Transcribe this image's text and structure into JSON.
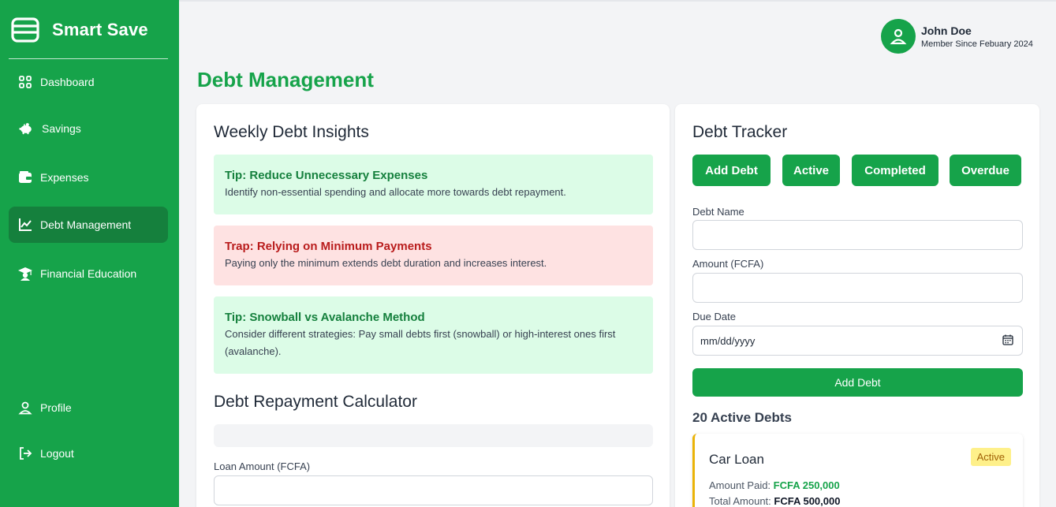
{
  "sidebar": {
    "brand": "Smart Save",
    "items": [
      {
        "label": "Dashboard",
        "icon": "grid-icon"
      },
      {
        "label": "Savings",
        "icon": "piggy-bank-icon"
      },
      {
        "label": "Expenses",
        "icon": "wallet-icon"
      },
      {
        "label": "Debt Management",
        "icon": "chart-line-icon",
        "active": true
      },
      {
        "label": "Financial Education",
        "icon": "graduation-cap-icon"
      },
      {
        "label": "Profile",
        "icon": "user-icon"
      },
      {
        "label": "Logout",
        "icon": "logout-icon"
      }
    ]
  },
  "header": {
    "user_name": "John Doe",
    "member_since": "Member Since Febuary 2024"
  },
  "page_title": "Debt Management",
  "insights": {
    "heading": "Weekly Debt Insights",
    "notes": [
      {
        "kind": "tip",
        "title": "Tip: Reduce Unnecessary Expenses",
        "body": "Identify non-essential spending and allocate more towards debt repayment."
      },
      {
        "kind": "trap",
        "title": "Trap: Relying on Minimum Payments",
        "body": "Paying only the minimum extends debt duration and increases interest."
      },
      {
        "kind": "tip",
        "title": "Tip: Snowball vs Avalanche Method",
        "body": "Consider different strategies: Pay small debts first (snowball) or high-interest ones first (avalanche)."
      }
    ]
  },
  "calculator": {
    "heading": "Debt Repayment Calculator",
    "loan_amount_label": "Loan Amount (FCFA)",
    "loan_amount_value": ""
  },
  "tracker": {
    "heading": "Debt Tracker",
    "tabs": [
      "Add Debt",
      "Active",
      "Completed",
      "Overdue"
    ],
    "form": {
      "name_label": "Debt Name",
      "name_value": "",
      "amount_label": "Amount (FCFA)",
      "amount_value": "",
      "due_label": "Due Date",
      "due_placeholder": "mm/dd/yyyy",
      "submit_label": "Add Debt"
    },
    "active_heading": "20 Active Debts",
    "debts": [
      {
        "name": "Car Loan",
        "status": "Active",
        "amount_paid_label": "Amount Paid:",
        "amount_paid": "FCFA 250,000",
        "total_label": "Total Amount:",
        "total": "FCFA 500,000"
      }
    ]
  },
  "colors": {
    "brand_green": "#16a34a",
    "active_nav": "#15803d",
    "tip_bg": "#dcfce7",
    "trap_bg": "#fee2e2",
    "badge_bg": "#fef08a"
  }
}
